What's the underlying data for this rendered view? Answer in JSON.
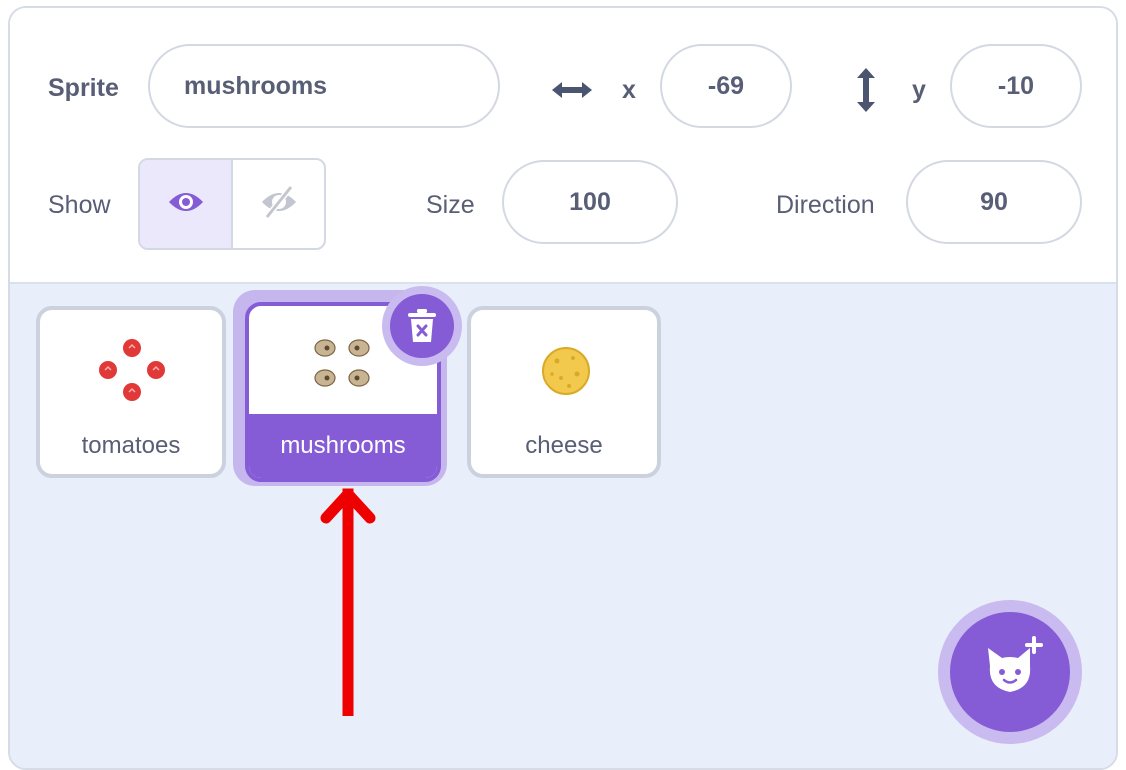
{
  "sprite_info": {
    "sprite_label": "Sprite",
    "sprite_name": "mushrooms",
    "x_label": "x",
    "x_value": "-69",
    "y_label": "y",
    "y_value": "-10",
    "show_label": "Show",
    "size_label": "Size",
    "size_value": "100",
    "direction_label": "Direction",
    "direction_value": "90"
  },
  "sprites": [
    {
      "name": "tomatoes",
      "selected": false
    },
    {
      "name": "mushrooms",
      "selected": true
    },
    {
      "name": "cheese",
      "selected": false
    }
  ],
  "icons": {
    "x_axis": "horizontal-arrows-icon",
    "y_axis": "vertical-arrows-icon",
    "show": "eye-icon",
    "hide": "eye-slash-icon",
    "delete": "trash-icon",
    "add_sprite": "cat-plus-icon"
  },
  "colors": {
    "accent": "#855cd6",
    "accent_light": "#c9baf0",
    "arrow": "#ee0000",
    "panel_bg": "#e8eefa"
  }
}
